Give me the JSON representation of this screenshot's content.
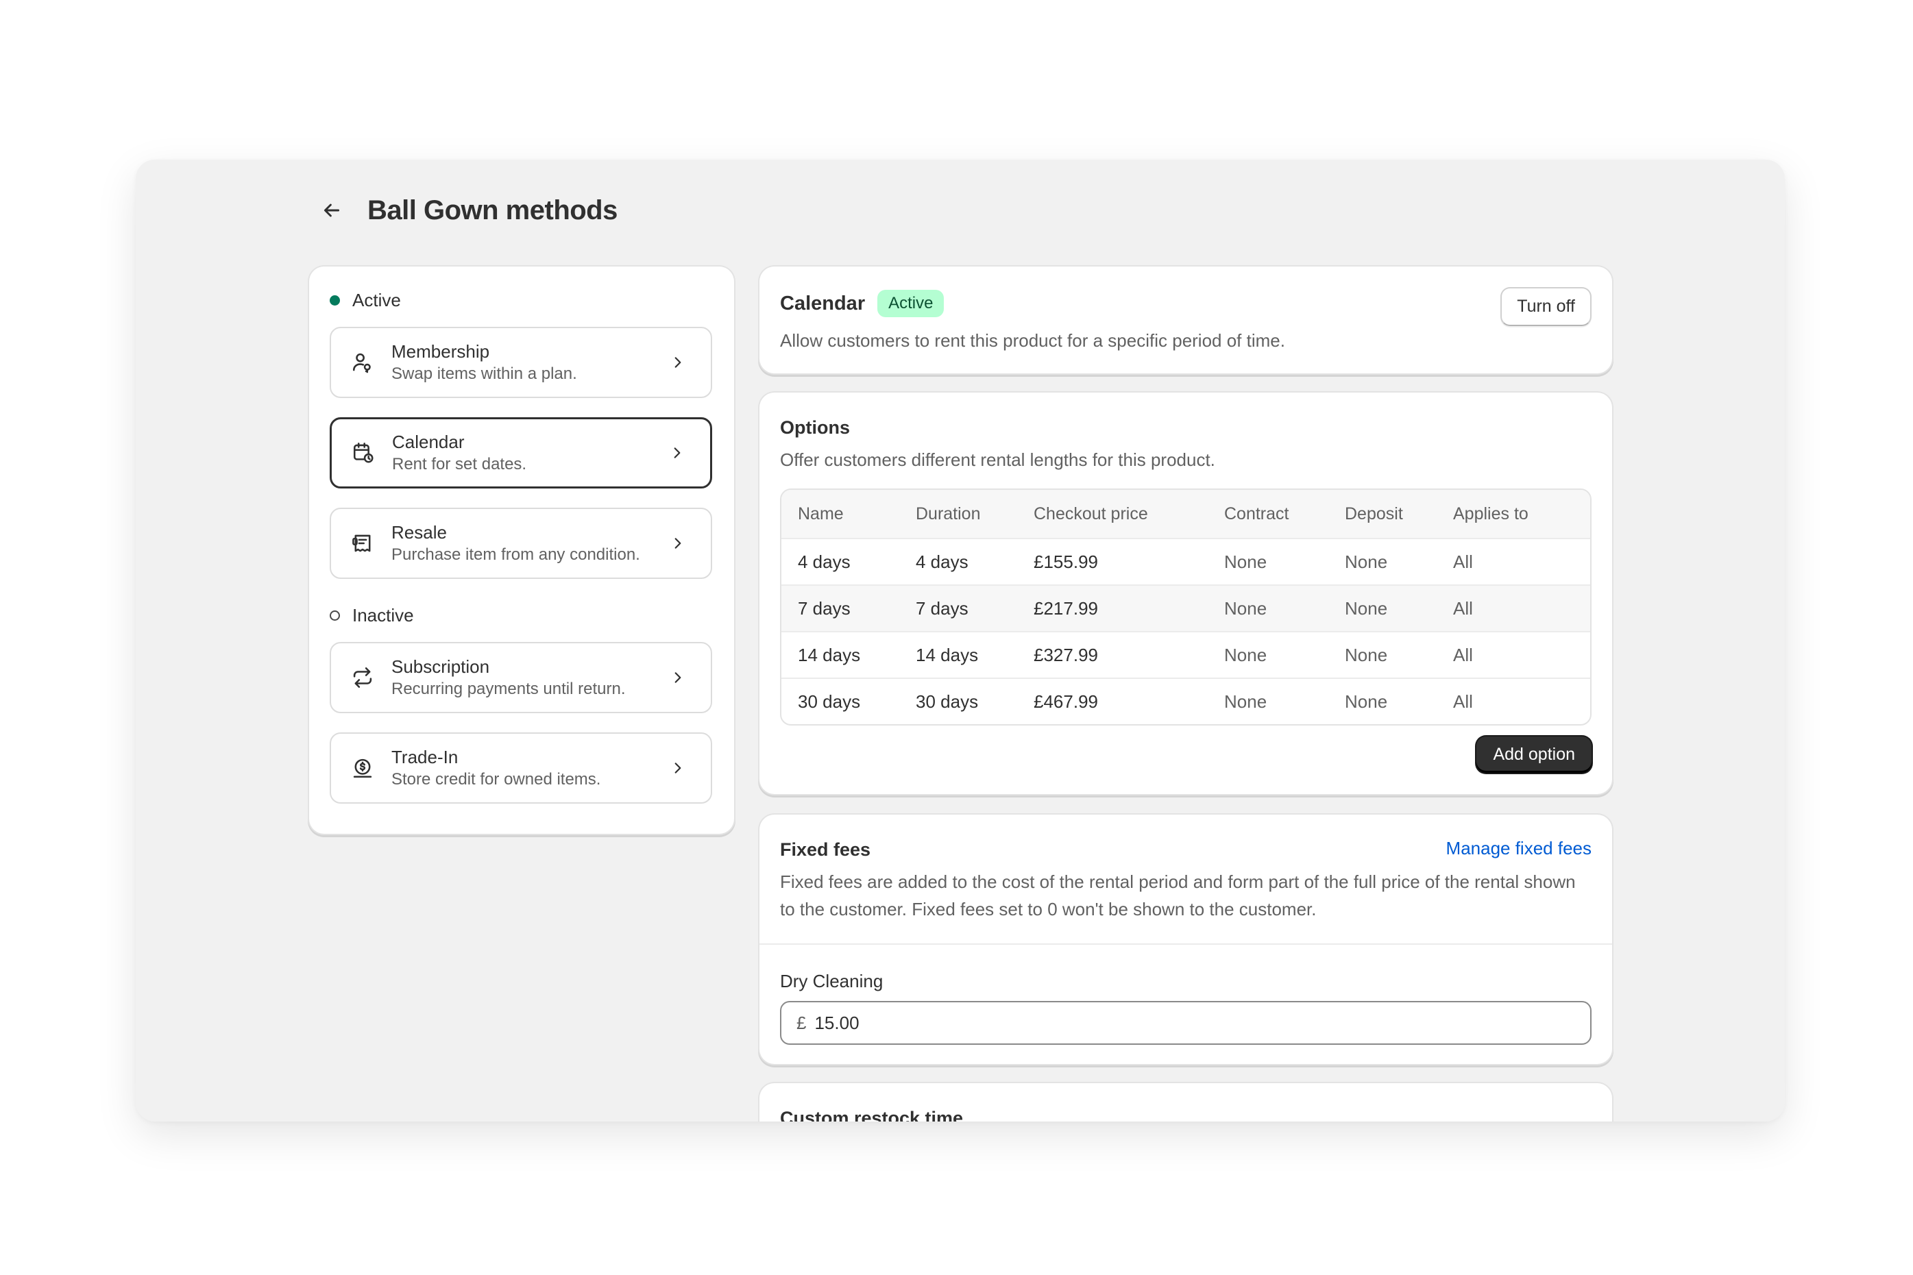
{
  "page": {
    "title": "Ball Gown methods"
  },
  "methods": {
    "active_label": "Active",
    "inactive_label": "Inactive",
    "active": [
      {
        "title": "Membership",
        "subtitle": "Swap items within a plan."
      },
      {
        "title": "Calendar",
        "subtitle": "Rent for set dates."
      },
      {
        "title": "Resale",
        "subtitle": "Purchase item from any condition."
      }
    ],
    "inactive": [
      {
        "title": "Subscription",
        "subtitle": "Recurring payments until return."
      },
      {
        "title": "Trade-In",
        "subtitle": "Store credit for owned items."
      }
    ]
  },
  "calendar": {
    "title": "Calendar",
    "badge": "Active",
    "description": "Allow customers to rent this product for a specific period of time.",
    "turn_off_label": "Turn off"
  },
  "options": {
    "title": "Options",
    "description": "Offer customers different rental lengths for this product.",
    "columns": [
      "Name",
      "Duration",
      "Checkout price",
      "Contract",
      "Deposit",
      "Applies to"
    ],
    "rows": [
      [
        "4 days",
        "4 days",
        "£155.99",
        "None",
        "None",
        "All"
      ],
      [
        "7 days",
        "7 days",
        "£217.99",
        "None",
        "None",
        "All"
      ],
      [
        "14 days",
        "14 days",
        "£327.99",
        "None",
        "None",
        "All"
      ],
      [
        "30 days",
        "30 days",
        "£467.99",
        "None",
        "None",
        "All"
      ]
    ],
    "add_label": "Add option"
  },
  "fixed_fees": {
    "title": "Fixed fees",
    "manage_label": "Manage fixed fees",
    "description": "Fixed fees are added to the cost of the rental period and form part of the full price of the rental shown to the customer. Fixed fees set to 0 won't be shown to the customer.",
    "field_label": "Dry Cleaning",
    "currency": "£",
    "value": "15.00"
  },
  "restock": {
    "title": "Custom restock time"
  },
  "colors": {
    "active_dot": "#047b5d",
    "badge_bg": "#b4fed2",
    "link": "#005bd3",
    "primary_button": "#303030"
  }
}
